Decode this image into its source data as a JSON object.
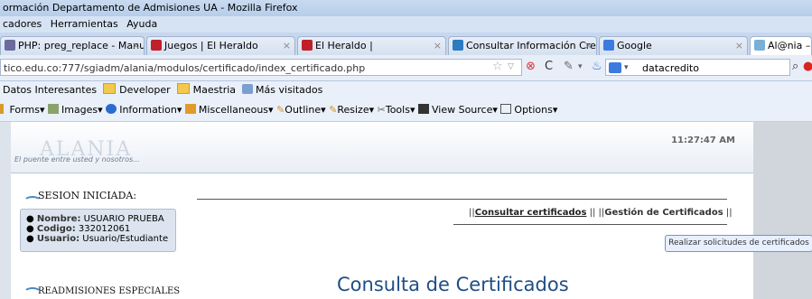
{
  "window": {
    "title": "ormación Departamento de Admisiones UA - Mozilla Firefox"
  },
  "menu": {
    "items": [
      "cadores",
      "Herramientas",
      "Ayuda"
    ]
  },
  "tabs": [
    {
      "label": "PHP: preg_replace - Manual",
      "icon": "php-icon",
      "color": "#6b6b9c"
    },
    {
      "label": "Juegos | El Heraldo",
      "icon": "heraldo-icon",
      "color": "#c0202a"
    },
    {
      "label": "El Heraldo |",
      "icon": "heraldo-icon",
      "color": "#c0202a"
    },
    {
      "label": "Consultar Información Cred...",
      "icon": "credit-icon",
      "color": "#2a7bbf"
    },
    {
      "label": "Google",
      "icon": "google-icon",
      "color": "#3b7be0"
    },
    {
      "label": "Al@nia – Sis",
      "icon": "alania-icon",
      "color": "#7ab0d6"
    }
  ],
  "nav": {
    "url": "tico.edu.co:777/sgiadm/alania/modulos/certificado/index_certificado.php",
    "search_value": "datacredito"
  },
  "bookmarks": {
    "items": [
      "Datos Interesantes",
      "Developer",
      "Maestria",
      "Más visitados"
    ]
  },
  "devtoolbar": {
    "items": [
      "Forms",
      "Images",
      "Information",
      "Miscellaneous",
      "Outline",
      "Resize",
      "Tools",
      "View Source",
      "Options"
    ]
  },
  "page": {
    "logo": "ALANIA",
    "slogan": "El puente entre usted y nosotros...",
    "clock": "11:27:47 AM",
    "session_title": "SESION INICIADA:",
    "user": {
      "nombre_label": "Nombre:",
      "nombre": "USUARIO PRUEBA",
      "codigo_label": "Codigo:",
      "codigo": "332012061",
      "usuario_label": "Usuario:",
      "usuario": "Usuario/Estudiante"
    },
    "links": {
      "sep1": "||",
      "consultar": "Consultar certificados",
      "sep2": "|| ||",
      "gestion": "Gestión de Certificados",
      "sep3": "||"
    },
    "tooltip": "Realizar solicitudes de certificados",
    "readmisiones": "READMISIONES ESPECIALES",
    "main_title": "Consulta de Certificados"
  }
}
